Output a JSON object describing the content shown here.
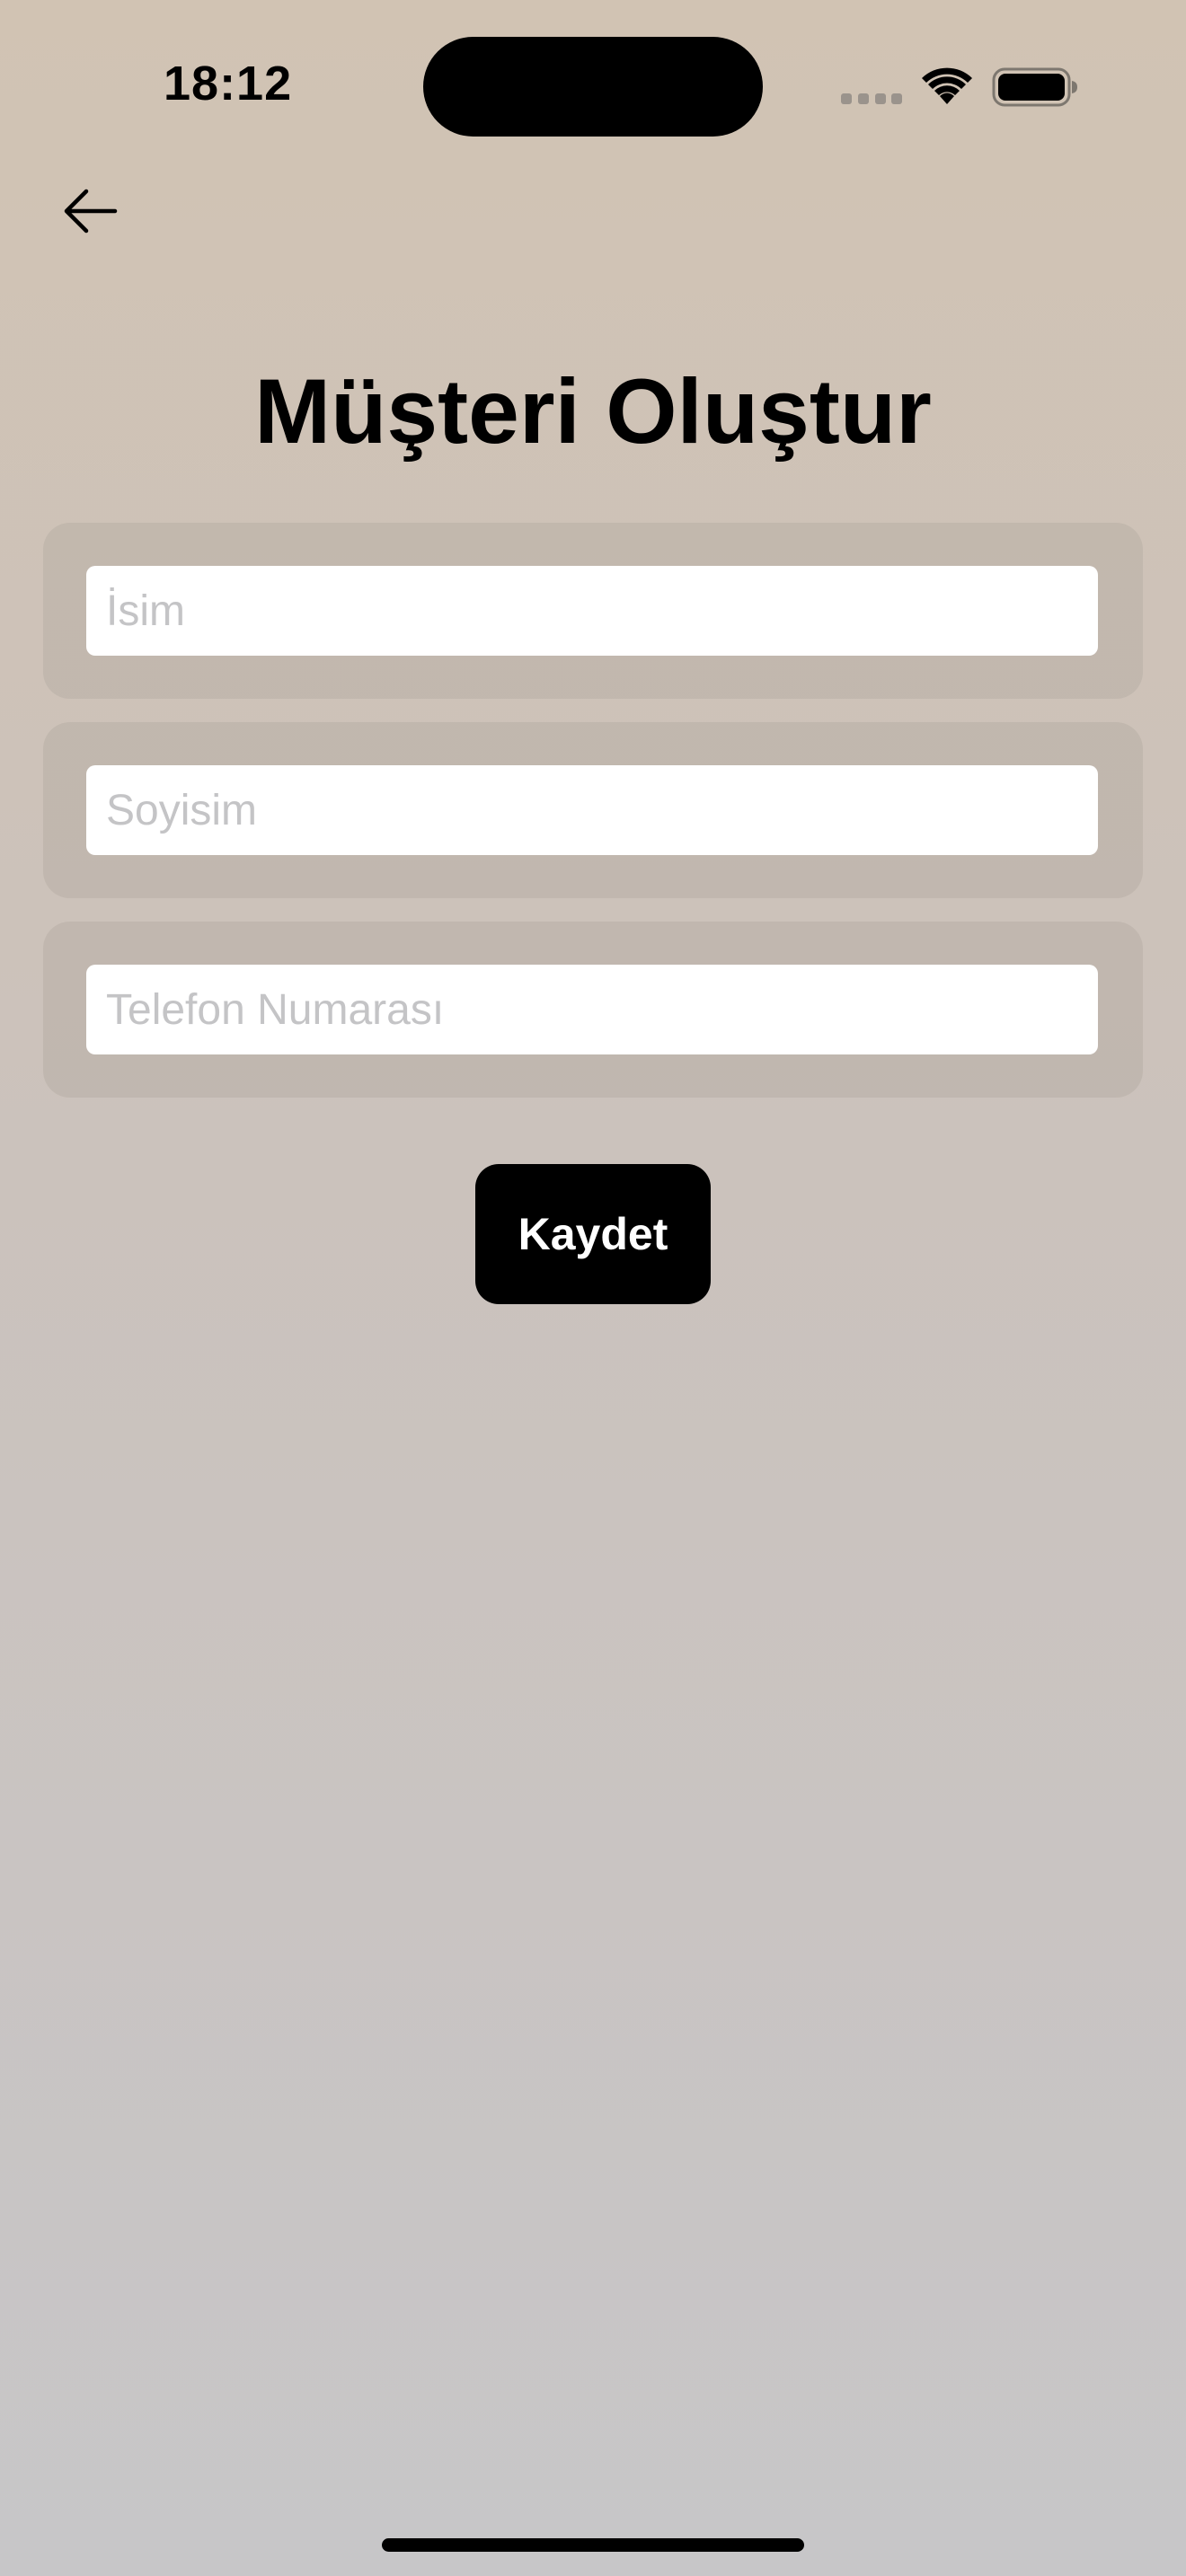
{
  "status_bar": {
    "time": "18:12"
  },
  "header": {
    "back_icon": "arrow-left-icon",
    "title": "Müşteri Oluştur"
  },
  "form": {
    "fields": [
      {
        "placeholder": "İsim",
        "value": ""
      },
      {
        "placeholder": "Soyisim",
        "value": ""
      },
      {
        "placeholder": "Telefon Numarası",
        "value": ""
      }
    ],
    "save_label": "Kaydet"
  },
  "colors": {
    "background_top": "#d1c3b3",
    "background_bottom": "#c7c6c8",
    "button": "#000000",
    "button_text": "#ffffff",
    "placeholder": "#c4c4c6"
  }
}
